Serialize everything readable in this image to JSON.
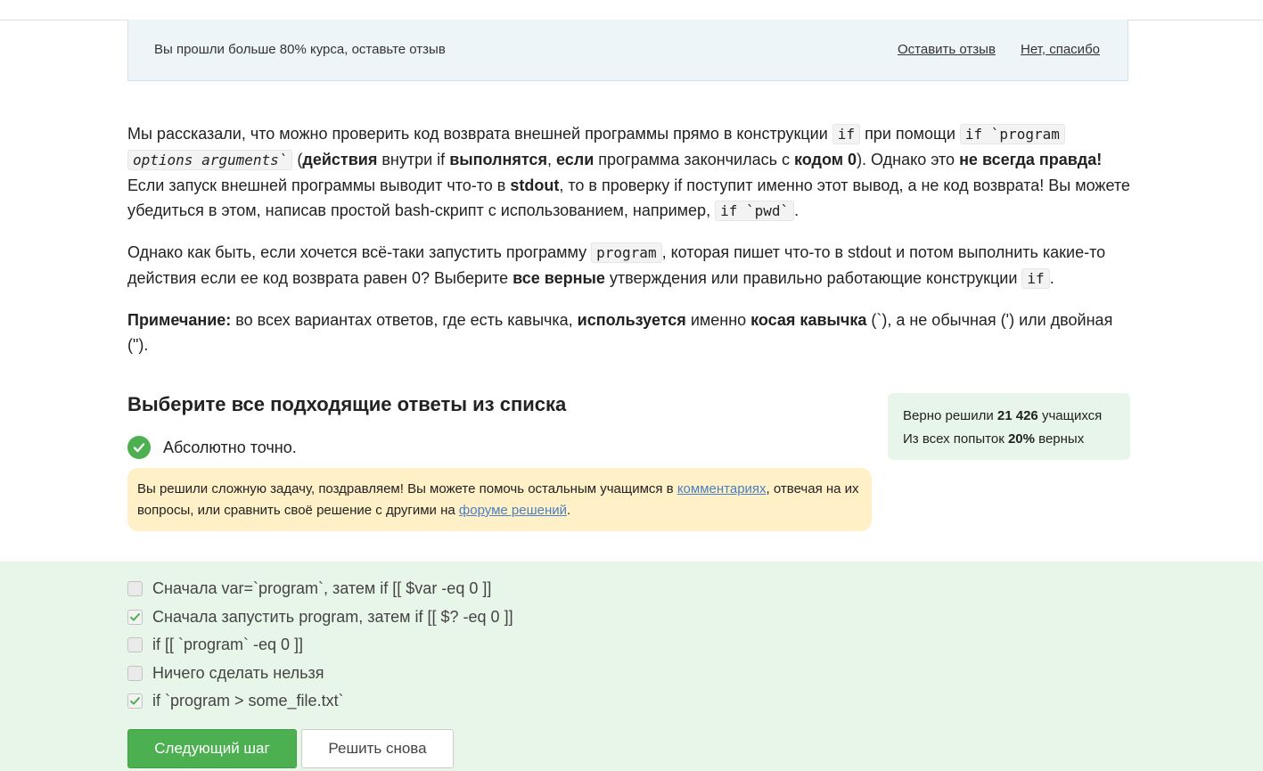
{
  "banner": {
    "text": "Вы прошли больше 80% курса, оставьте отзыв",
    "leave_review": "Оставить отзыв",
    "no_thanks": "Нет, спасибо"
  },
  "lesson": {
    "p1": [
      "Мы рассказали, что можно проверить код возврата внешней программы прямо в конструкции ",
      "if",
      " при помощи ",
      "if `program",
      "options arguments`",
      " (",
      "действия",
      " внутри if ",
      "выполнятся",
      ", ",
      "если",
      " программа закончилась с ",
      "кодом 0",
      "). Однако это ",
      "не всегда правда!",
      " Если запуск внешней программы выводит что-то в ",
      "stdout",
      ", то в проверку if поступит именно этот вывод, а не код возврата! Вы можете убедиться в этом, написав простой bash-скрипт с использованием, например, ",
      "if `pwd`",
      "."
    ],
    "p2": [
      "Однако как быть, если хочется всё-таки запустить программу ",
      "program",
      ", которая пишет что-то в stdout и потом выполнить какие-то действия если ее код возврата равен 0? Выберите ",
      "все верные",
      " утверждения или правильно работающие конструкции ",
      "if",
      "."
    ],
    "p3": [
      "Примечание:",
      " во всех вариантах ответов, где есть кавычка, ",
      "используется",
      " именно ",
      "косая кавычка",
      " (`), а не обычная (') или двойная (\")."
    ]
  },
  "quiz": {
    "title": "Выберите все подходящие ответы из списка",
    "result": "Абсолютно точно.",
    "congrats_before": "Вы решили сложную задачу, поздравляем! Вы можете помочь остальным учащимся в ",
    "congrats_link1": "комментариях",
    "congrats_middle": ", отвечая на их вопросы, или сравнить своё решение с другими на ",
    "congrats_link2": "форуме решений",
    "congrats_after": "."
  },
  "stats": {
    "solved_prefix": "Верно решили ",
    "solved_count": "21 426",
    "solved_suffix": " учащихся",
    "attempts_prefix": "Из всех попыток ",
    "attempts_percent": "20%",
    "attempts_suffix": " верных"
  },
  "options": [
    {
      "label": "Сначала var=`program`, затем if [[ $var -eq 0 ]]",
      "checked": false
    },
    {
      "label": "Сначала запустить program, затем if [[ $? -eq 0 ]]",
      "checked": true
    },
    {
      "label": "if [[ `program` -eq 0 ]]",
      "checked": false
    },
    {
      "label": "Ничего сделать нельзя",
      "checked": false
    },
    {
      "label": "if `program > some_file.txt`",
      "checked": true
    }
  ],
  "buttons": {
    "next": "Следующий шаг",
    "retry": "Решить снова"
  },
  "colors": {
    "accent_green": "#4caf50",
    "answers_bg": "#e8f5e9",
    "banner_bg": "#eef5f9",
    "congrats_bg": "#fff0c8",
    "link": "#4a7fc1"
  },
  "icons": {
    "result": "checkmark-circle-icon",
    "option_checked": "checkmark-icon"
  }
}
